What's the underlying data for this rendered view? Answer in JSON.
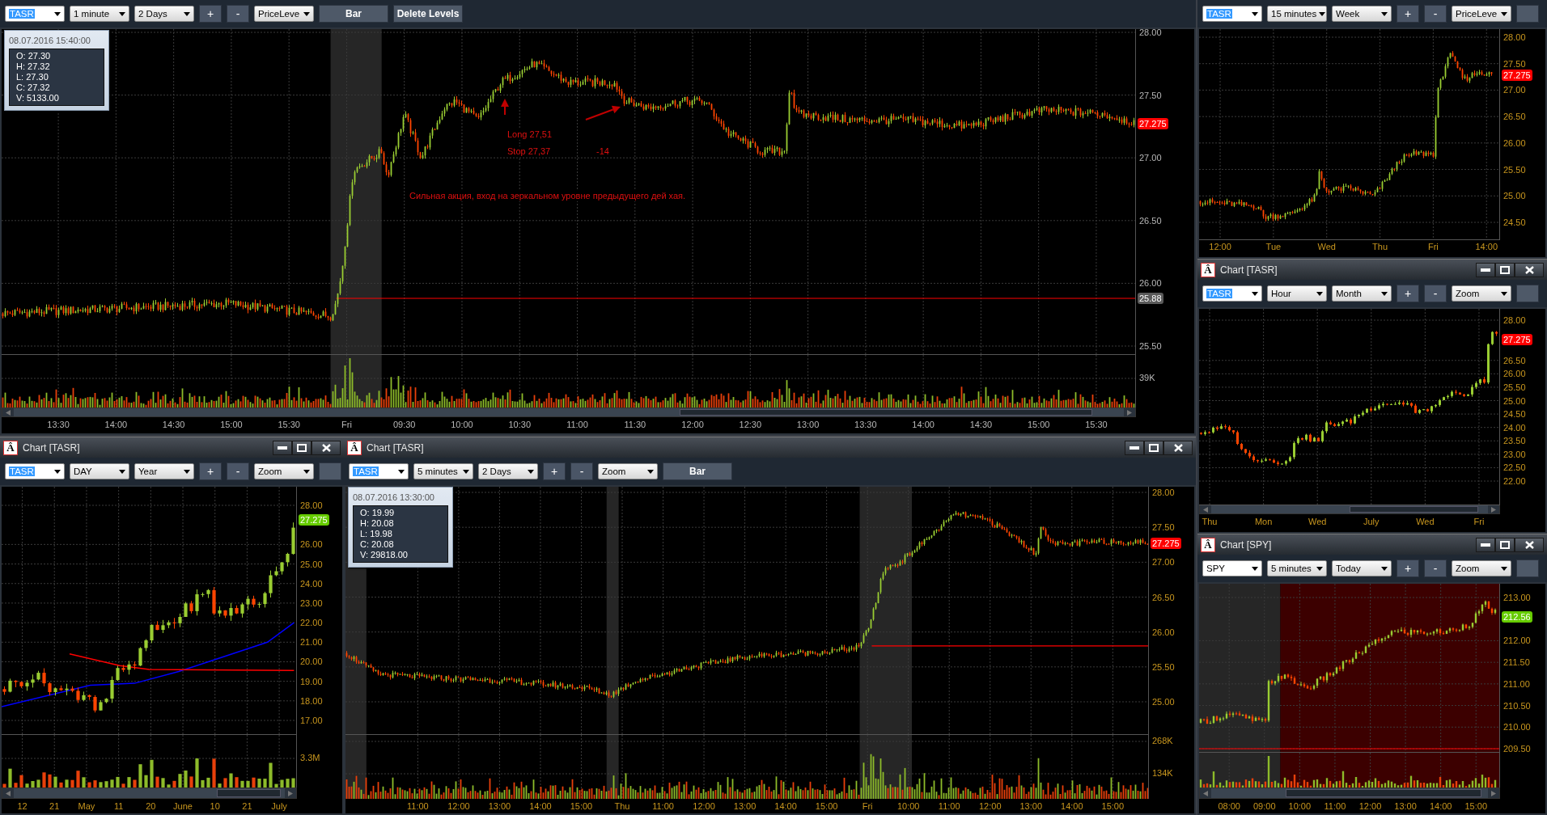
{
  "windows": [
    {
      "toolbar": [
        {
          "kind": "symbol",
          "text": "TASR",
          "selected": true
        },
        {
          "kind": "dropdown",
          "text": "1 minute"
        },
        {
          "kind": "dropdown",
          "text": "2 Days"
        },
        {
          "kind": "step",
          "text": "+"
        },
        {
          "kind": "step",
          "text": "-"
        },
        {
          "kind": "dropdown",
          "text": "PriceLeve"
        },
        {
          "kind": "wide",
          "text": "Bar"
        },
        {
          "kind": "wide",
          "text": "Delete Levels"
        }
      ],
      "info": {
        "datetime": "08.07.2016 15:40:00",
        "values": [
          "O: 27.30",
          "H: 27.32",
          "L: 27.30",
          "C: 27.32",
          "V: 5133.00"
        ]
      },
      "annotations": [
        "Long 27,51",
        "Stop 27,37",
        "-14",
        "Сильная акция, вход на зеркальном уровне предыдущего дей хая."
      ],
      "price_ticks": [
        "28.00",
        "27.50",
        "27.00",
        "26.50",
        "26.00",
        "25.50"
      ],
      "last_price": {
        "text": "27.275",
        "color": "#ff0000"
      },
      "price_level": {
        "text": "25.88"
      },
      "volume_ticks": [
        "39K"
      ],
      "scrollbar": true,
      "time_ticks": [
        "13:30",
        "14:00",
        "14:30",
        "15:00",
        "15:30",
        "Fri",
        "09:30",
        "10:00",
        "10:30",
        "11:00",
        "11:30",
        "12:00",
        "12:30",
        "13:00",
        "13:30",
        "14:00",
        "14:30",
        "15:00",
        "15:30"
      ]
    },
    {
      "toolbar": [
        {
          "kind": "symbol",
          "text": "TASR",
          "selected": true
        },
        {
          "kind": "dropdown",
          "text": "15 minutes"
        },
        {
          "kind": "dropdown",
          "text": "Week"
        },
        {
          "kind": "step",
          "text": "+"
        },
        {
          "kind": "step",
          "text": "-"
        },
        {
          "kind": "dropdown",
          "text": "PriceLeve"
        },
        {
          "kind": "blank"
        }
      ],
      "price_ticks": [
        "28.00",
        "27.50",
        "27.00",
        "26.50",
        "26.00",
        "25.50",
        "25.00",
        "24.50"
      ],
      "last_price": {
        "text": "27.275",
        "color": "#ff0000"
      },
      "scrollbar": false,
      "time_ticks": [
        "12:00",
        "Tue",
        "Wed",
        "Thu",
        "Fri",
        "14:00"
      ]
    },
    {
      "title_icon": "Â",
      "title": "Chart [TASR]",
      "toolbar": [
        {
          "kind": "symbol",
          "text": "TASR",
          "selected": true
        },
        {
          "kind": "dropdown",
          "text": "Hour"
        },
        {
          "kind": "dropdown",
          "text": "Month"
        },
        {
          "kind": "step",
          "text": "+"
        },
        {
          "kind": "step",
          "text": "-"
        },
        {
          "kind": "dropdown",
          "text": "Zoom"
        },
        {
          "kind": "blank"
        }
      ],
      "price_ticks": [
        "28.00",
        "26.50",
        "26.00",
        "25.50",
        "25.00",
        "24.50",
        "24.00",
        "23.50",
        "23.00",
        "22.50",
        "22.00"
      ],
      "last_price": {
        "text": "27.275",
        "color": "#ff0000"
      },
      "scrollbar": true,
      "time_ticks": [
        "Thu",
        "Mon",
        "Wed",
        "July",
        "Wed",
        "Fri"
      ]
    },
    {
      "title_icon": "Â",
      "title": "Chart [TASR]",
      "toolbar": [
        {
          "kind": "symbol",
          "text": "TASR",
          "selected": true
        },
        {
          "kind": "dropdown",
          "text": "DAY"
        },
        {
          "kind": "dropdown",
          "text": "Year"
        },
        {
          "kind": "step",
          "text": "+"
        },
        {
          "kind": "step",
          "text": "-"
        },
        {
          "kind": "dropdown",
          "text": "Zoom"
        },
        {
          "kind": "blank"
        }
      ],
      "price_ticks": [
        "28.00",
        "26.00",
        "25.00",
        "24.00",
        "23.00",
        "22.00",
        "21.00",
        "20.00",
        "19.00",
        "18.00",
        "17.00"
      ],
      "last_price": {
        "text": "27.275",
        "color": "#66cc00"
      },
      "volume_ticks": [
        "3.3M"
      ],
      "scrollbar": true,
      "time_ticks": [
        "12",
        "21",
        "May",
        "11",
        "20",
        "June",
        "10",
        "21",
        "July"
      ]
    },
    {
      "title_icon": "Â",
      "title": "Chart [TASR]",
      "toolbar": [
        {
          "kind": "symbol",
          "text": "TASR",
          "selected": true
        },
        {
          "kind": "dropdown",
          "text": "5 minutes"
        },
        {
          "kind": "dropdown",
          "text": "2 Days"
        },
        {
          "kind": "step",
          "text": "+"
        },
        {
          "kind": "step",
          "text": "-"
        },
        {
          "kind": "dropdown",
          "text": "Zoom"
        },
        {
          "kind": "wide",
          "text": "Bar"
        }
      ],
      "info": {
        "datetime": "08.07.2016 13:30:00",
        "values": [
          "O: 19.99",
          "H: 20.08",
          "L: 19.98",
          "C: 20.08",
          "V: 29818.00"
        ]
      },
      "price_ticks": [
        "28.00",
        "27.50",
        "27.00",
        "26.50",
        "26.00",
        "25.50",
        "25.00"
      ],
      "last_price": {
        "text": "27.275",
        "color": "#ff0000"
      },
      "volume_ticks": [
        "268K",
        "134K"
      ],
      "scrollbar": false,
      "time_ticks": [
        "11:00",
        "12:00",
        "13:00",
        "14:00",
        "15:00",
        "Thu",
        "11:00",
        "12:00",
        "13:00",
        "14:00",
        "15:00",
        "Fri",
        "10:00",
        "11:00",
        "12:00",
        "13:00",
        "14:00",
        "15:00"
      ]
    },
    {
      "title_icon": "Â",
      "title": "Chart [SPY]",
      "toolbar": [
        {
          "kind": "symbol",
          "text": "SPY",
          "selected": false
        },
        {
          "kind": "dropdown",
          "text": "5 minutes"
        },
        {
          "kind": "dropdown",
          "text": "Today"
        },
        {
          "kind": "step",
          "text": "+"
        },
        {
          "kind": "step",
          "text": "-"
        },
        {
          "kind": "dropdown",
          "text": "Zoom"
        },
        {
          "kind": "blank"
        }
      ],
      "price_ticks": [
        "213.00",
        "212.00",
        "211.50",
        "211.00",
        "210.50",
        "210.00",
        "209.50"
      ],
      "last_price": {
        "text": "212.56",
        "color": "#66cc00"
      },
      "scrollbar": true,
      "time_ticks": [
        "08:00",
        "09:00",
        "10:00",
        "11:00",
        "12:00",
        "13:00",
        "14:00",
        "15:00"
      ]
    }
  ]
}
